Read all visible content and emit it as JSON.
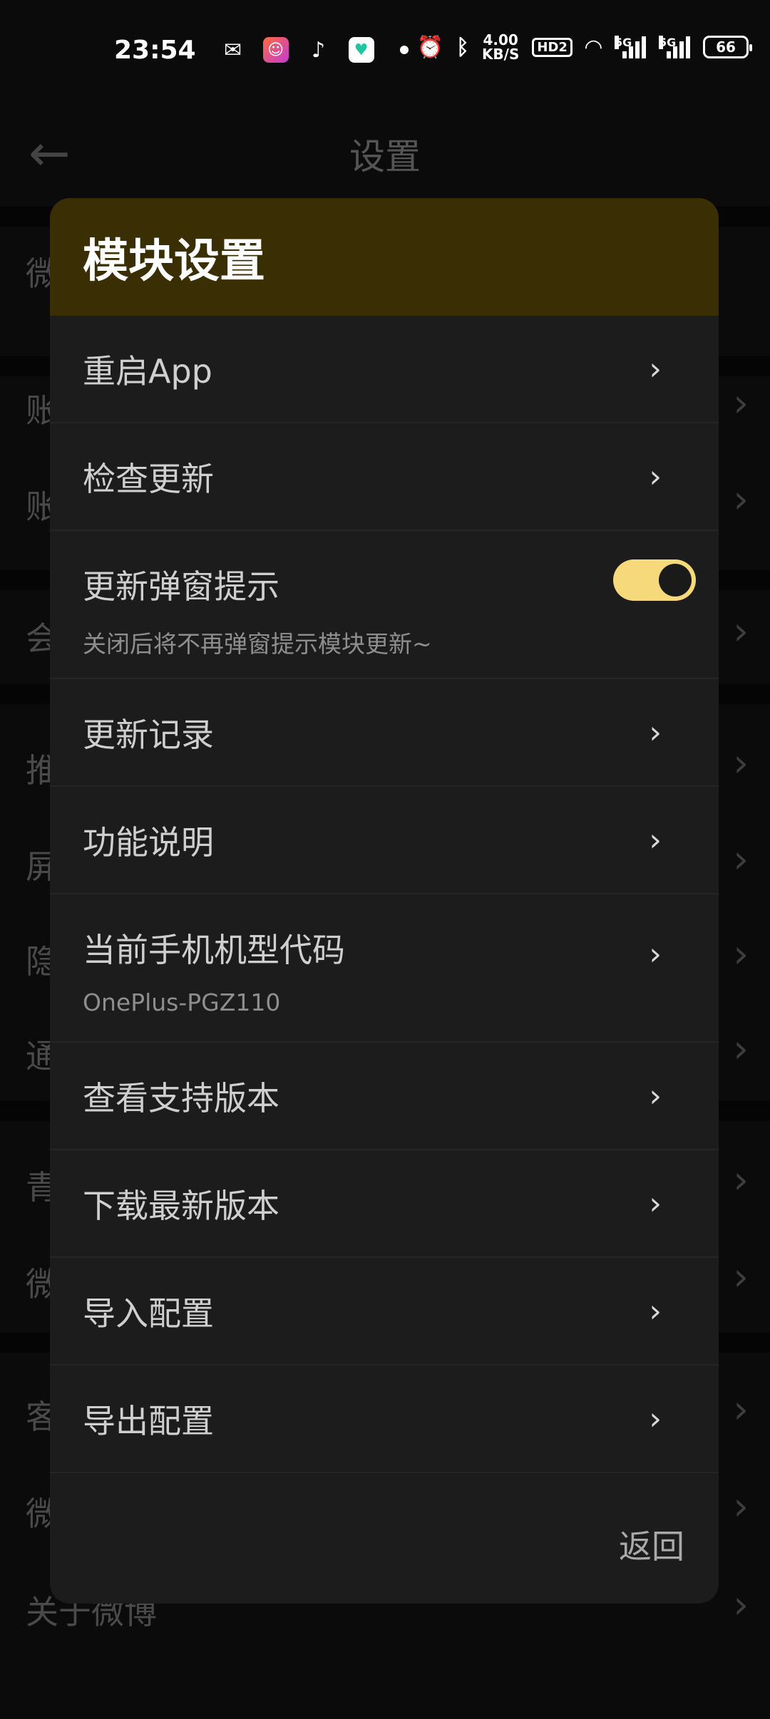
{
  "status_bar": {
    "time": "23:54",
    "net_speed_value": "4.00",
    "net_speed_unit": "KB/S",
    "hd_label": "HD2",
    "sim1_label": "5G",
    "sim2_label": "5G",
    "battery": "66",
    "icons": [
      "wechat-icon",
      "app-icon",
      "tiktok-icon",
      "heart-app-icon",
      "alarm-icon",
      "bluetooth-icon",
      "wifi-icon"
    ]
  },
  "background_page": {
    "title": "设置",
    "rows": [
      {
        "label": "微"
      },
      {
        "label": "账"
      },
      {
        "label": "账"
      },
      {
        "label": "会"
      },
      {
        "label": "推"
      },
      {
        "label": "屏"
      },
      {
        "label": "隐"
      },
      {
        "label": "通"
      },
      {
        "label": "青"
      },
      {
        "label": "微"
      },
      {
        "label": "客"
      },
      {
        "label": "微"
      },
      {
        "label": "关于微博"
      }
    ]
  },
  "dialog": {
    "title": "模块设置",
    "items": [
      {
        "label": "重启App"
      },
      {
        "label": "检查更新"
      },
      {
        "label": "更新弹窗提示",
        "sub": "关闭后将不再弹窗提示模块更新~",
        "toggle_on": true
      },
      {
        "label": "更新记录"
      },
      {
        "label": "功能说明"
      },
      {
        "label": "当前手机机型代码",
        "sub": "OnePlus-PGZ110"
      },
      {
        "label": "查看支持版本"
      },
      {
        "label": "下载最新版本"
      },
      {
        "label": "导入配置"
      },
      {
        "label": "导出配置"
      }
    ],
    "back_label": "返回"
  },
  "colors": {
    "accent": "#f5d97a",
    "header_bg": "#3a2e04",
    "dialog_bg": "#1c1c1c"
  }
}
